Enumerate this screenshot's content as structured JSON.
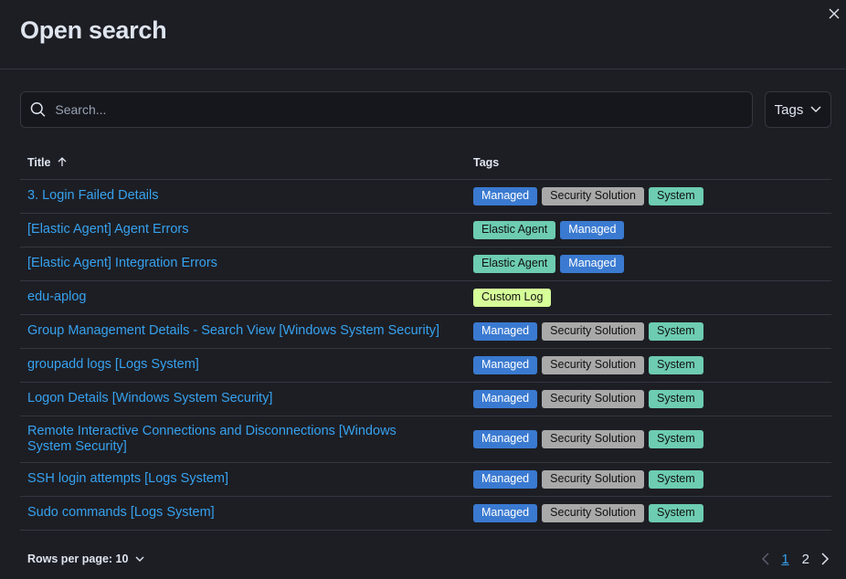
{
  "modal": {
    "title": "Open search"
  },
  "search": {
    "placeholder": "Search...",
    "value": ""
  },
  "filters": {
    "tags_label": "Tags"
  },
  "table": {
    "columns": {
      "title": "Title",
      "tags": "Tags"
    },
    "rows": [
      {
        "title": "3. Login Failed Details",
        "tags": [
          {
            "label": "Managed",
            "kind": "managed"
          },
          {
            "label": "Security Solution",
            "kind": "security"
          },
          {
            "label": "System",
            "kind": "system"
          }
        ]
      },
      {
        "title": "[Elastic Agent] Agent Errors",
        "tags": [
          {
            "label": "Elastic Agent",
            "kind": "elastic"
          },
          {
            "label": "Managed",
            "kind": "managed"
          }
        ]
      },
      {
        "title": "[Elastic Agent] Integration Errors",
        "tags": [
          {
            "label": "Elastic Agent",
            "kind": "elastic"
          },
          {
            "label": "Managed",
            "kind": "managed"
          }
        ]
      },
      {
        "title": "edu-aplog",
        "tags": [
          {
            "label": "Custom Log",
            "kind": "custom"
          }
        ]
      },
      {
        "title": "Group Management Details - Search View [Windows System Security]",
        "tags": [
          {
            "label": "Managed",
            "kind": "managed"
          },
          {
            "label": "Security Solution",
            "kind": "security"
          },
          {
            "label": "System",
            "kind": "system"
          }
        ]
      },
      {
        "title": "groupadd logs [Logs System]",
        "tags": [
          {
            "label": "Managed",
            "kind": "managed"
          },
          {
            "label": "Security Solution",
            "kind": "security"
          },
          {
            "label": "System",
            "kind": "system"
          }
        ]
      },
      {
        "title": "Logon Details [Windows System Security]",
        "tags": [
          {
            "label": "Managed",
            "kind": "managed"
          },
          {
            "label": "Security Solution",
            "kind": "security"
          },
          {
            "label": "System",
            "kind": "system"
          }
        ]
      },
      {
        "title": "Remote Interactive Connections and Disconnections [Windows System Security]",
        "tags": [
          {
            "label": "Managed",
            "kind": "managed"
          },
          {
            "label": "Security Solution",
            "kind": "security"
          },
          {
            "label": "System",
            "kind": "system"
          }
        ]
      },
      {
        "title": "SSH login attempts [Logs System]",
        "tags": [
          {
            "label": "Managed",
            "kind": "managed"
          },
          {
            "label": "Security Solution",
            "kind": "security"
          },
          {
            "label": "System",
            "kind": "system"
          }
        ]
      },
      {
        "title": "Sudo commands [Logs System]",
        "tags": [
          {
            "label": "Managed",
            "kind": "managed"
          },
          {
            "label": "Security Solution",
            "kind": "security"
          },
          {
            "label": "System",
            "kind": "system"
          }
        ]
      }
    ]
  },
  "pagination": {
    "rows_per_page_label": "Rows per page: 10",
    "pages": [
      "1",
      "2"
    ],
    "current_page": "1"
  },
  "colors": {
    "background": "#1d1e24",
    "link": "#36a2ef",
    "managed": "#3a7ad1",
    "security": "#a9a9a9",
    "system": "#6dccb1",
    "custom_log": "#d6ff99"
  }
}
